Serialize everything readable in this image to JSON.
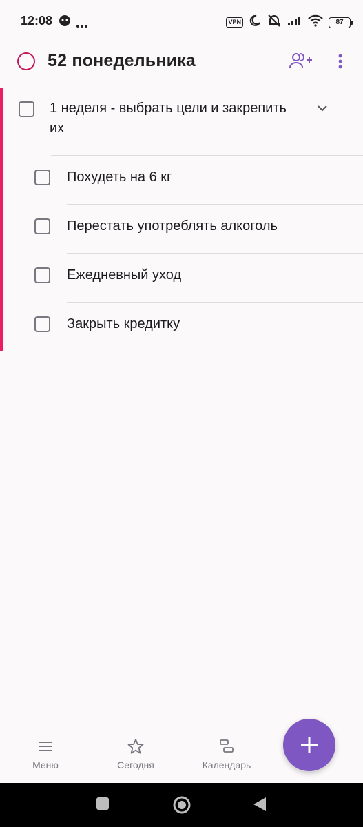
{
  "status_bar": {
    "time": "12:08",
    "vpn_label": "VPN",
    "battery_level": "87",
    "icons": [
      "app-notification-icon",
      "more-dots-icon",
      "vpn-icon",
      "moon-icon",
      "muted-alarm-icon",
      "signal-icon",
      "wifi-icon",
      "battery-icon"
    ]
  },
  "header": {
    "title": "52 понедельника",
    "accent_color": "#c2185b",
    "share_icon": "person-add-icon",
    "menu_icon": "more-vert-icon"
  },
  "tasks": {
    "parent": {
      "text": "1 неделя - выбрать цели и закрепить их",
      "expanded": true,
      "checked": false
    },
    "subtasks": [
      {
        "text": "Похудеть на 6 кг",
        "checked": false
      },
      {
        "text": "Перестать употреблять алкоголь",
        "checked": false
      },
      {
        "text": "Ежедневный уход",
        "checked": false
      },
      {
        "text": "Закрыть кредитку",
        "checked": false
      }
    ],
    "priority_color": "#e91e63"
  },
  "bottom_nav": {
    "items": [
      {
        "label": "Меню",
        "icon": "menu-icon"
      },
      {
        "label": "Сегодня",
        "icon": "star-icon"
      },
      {
        "label": "Календарь",
        "icon": "calendar-icon"
      }
    ],
    "fab_icon": "plus-icon",
    "fab_color": "#7e57c2"
  },
  "system_nav": {
    "icons": [
      "recents-square-icon",
      "home-circle-icon",
      "back-triangle-icon"
    ]
  }
}
